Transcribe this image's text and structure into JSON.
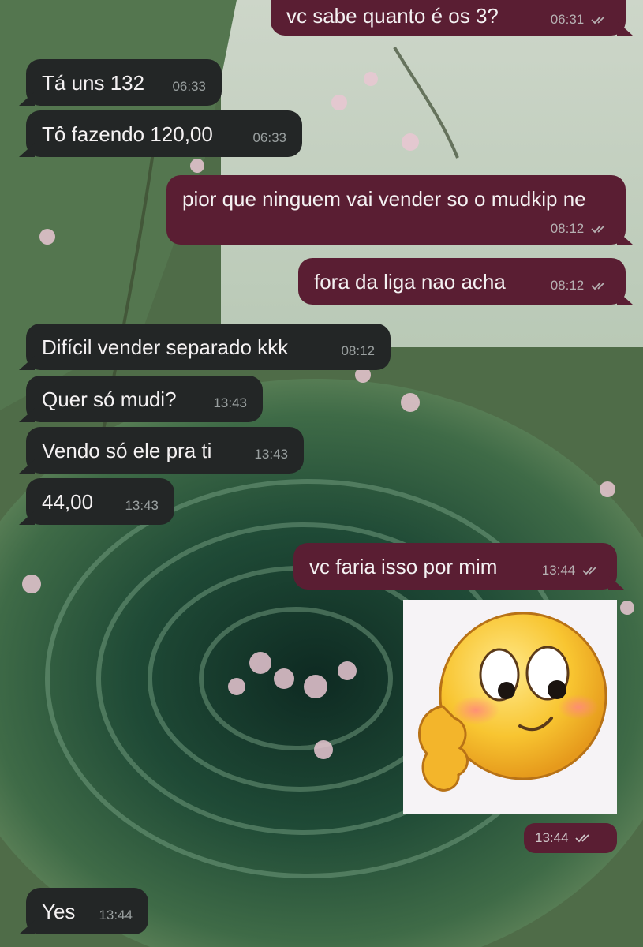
{
  "chat": {
    "messages": [
      {
        "direction": "out",
        "text": "vc sabe quanto é os 3?",
        "time": "06:31",
        "status": "read-ticks-icon"
      },
      {
        "direction": "in",
        "text": "Tá uns 132",
        "time": "06:33"
      },
      {
        "direction": "in",
        "text": "Tô fazendo 120,00",
        "time": "06:33"
      },
      {
        "direction": "out",
        "text": "pior que ninguem vai vender so o mudkip ne",
        "time": "08:12",
        "status": "read-ticks-icon"
      },
      {
        "direction": "out",
        "text": "fora da liga nao acha",
        "time": "08:12",
        "status": "read-ticks-icon"
      },
      {
        "direction": "in",
        "text": "Difícil vender separado kkk",
        "time": "08:12"
      },
      {
        "direction": "in",
        "text": "Quer só mudi?",
        "time": "13:43"
      },
      {
        "direction": "in",
        "text": "Vendo só ele pra ti",
        "time": "13:43"
      },
      {
        "direction": "in",
        "text": "44,00",
        "time": "13:43"
      },
      {
        "direction": "out",
        "text": "vc faria isso por mim",
        "time": "13:44",
        "status": "read-ticks-icon"
      },
      {
        "direction": "out",
        "type": "sticker",
        "sticker": "shy-emoji-sticker",
        "time": "13:44",
        "status": "read-ticks-icon"
      },
      {
        "direction": "in",
        "text": "Yes",
        "time": "13:44"
      }
    ]
  },
  "colors": {
    "incoming_bubble": "#232626",
    "outgoing_bubble": "#5a1e33",
    "text": "#f4f1f2"
  }
}
